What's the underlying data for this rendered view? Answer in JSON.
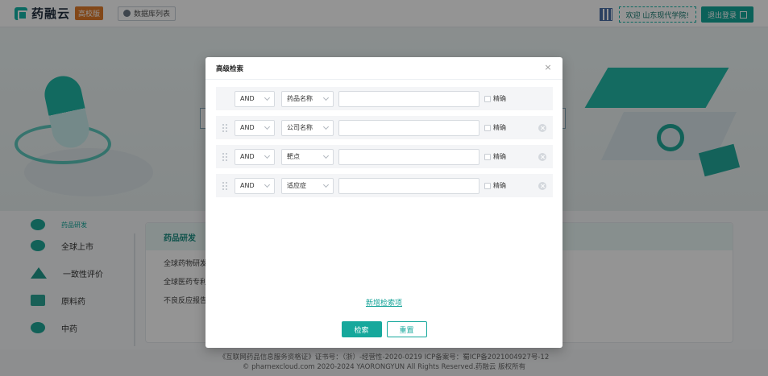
{
  "header": {
    "brand_name": "药融云",
    "brand_badge": "高校版",
    "db_list_label": "数据库列表",
    "welcome_text": "欢迎 山东现代学院!",
    "logout_label": "退出登录"
  },
  "sidebar": {
    "items": [
      {
        "label": "药品研发"
      },
      {
        "label": "全球上市"
      },
      {
        "label": "一致性评价"
      },
      {
        "label": "原料药"
      },
      {
        "label": "中药"
      }
    ]
  },
  "content": {
    "section_title": "药品研发",
    "lines": [
      "全球药物研发",
      "全球医药专利",
      "不良反应报告"
    ]
  },
  "footer": {
    "line1": "《互联网药品信息服务资格证》证书号：（浙）-经营性-2020-0219    ICP备案号：蜀ICP备2021004927号-12",
    "line2": "© pharnexcloud.com 2020-2024 YAORONGYUN All Rights Reserved.药融云 版权所有"
  },
  "modal": {
    "title": "高级检索",
    "close_glyph": "×",
    "rows": [
      {
        "operator": "AND",
        "field": "药品名称",
        "value": "",
        "exact_label": "精确",
        "removable": false
      },
      {
        "operator": "AND",
        "field": "公司名称",
        "value": "",
        "exact_label": "精确",
        "removable": true
      },
      {
        "operator": "AND",
        "field": "靶点",
        "value": "",
        "exact_label": "精确",
        "removable": true
      },
      {
        "operator": "AND",
        "field": "适应症",
        "value": "",
        "exact_label": "精确",
        "removable": true
      }
    ],
    "add_link": "新增检索项",
    "search_button": "检索",
    "reset_button": "重置"
  },
  "colors": {
    "accent": "#16a89c",
    "overlay": "rgba(0,0,0,0.42)"
  }
}
